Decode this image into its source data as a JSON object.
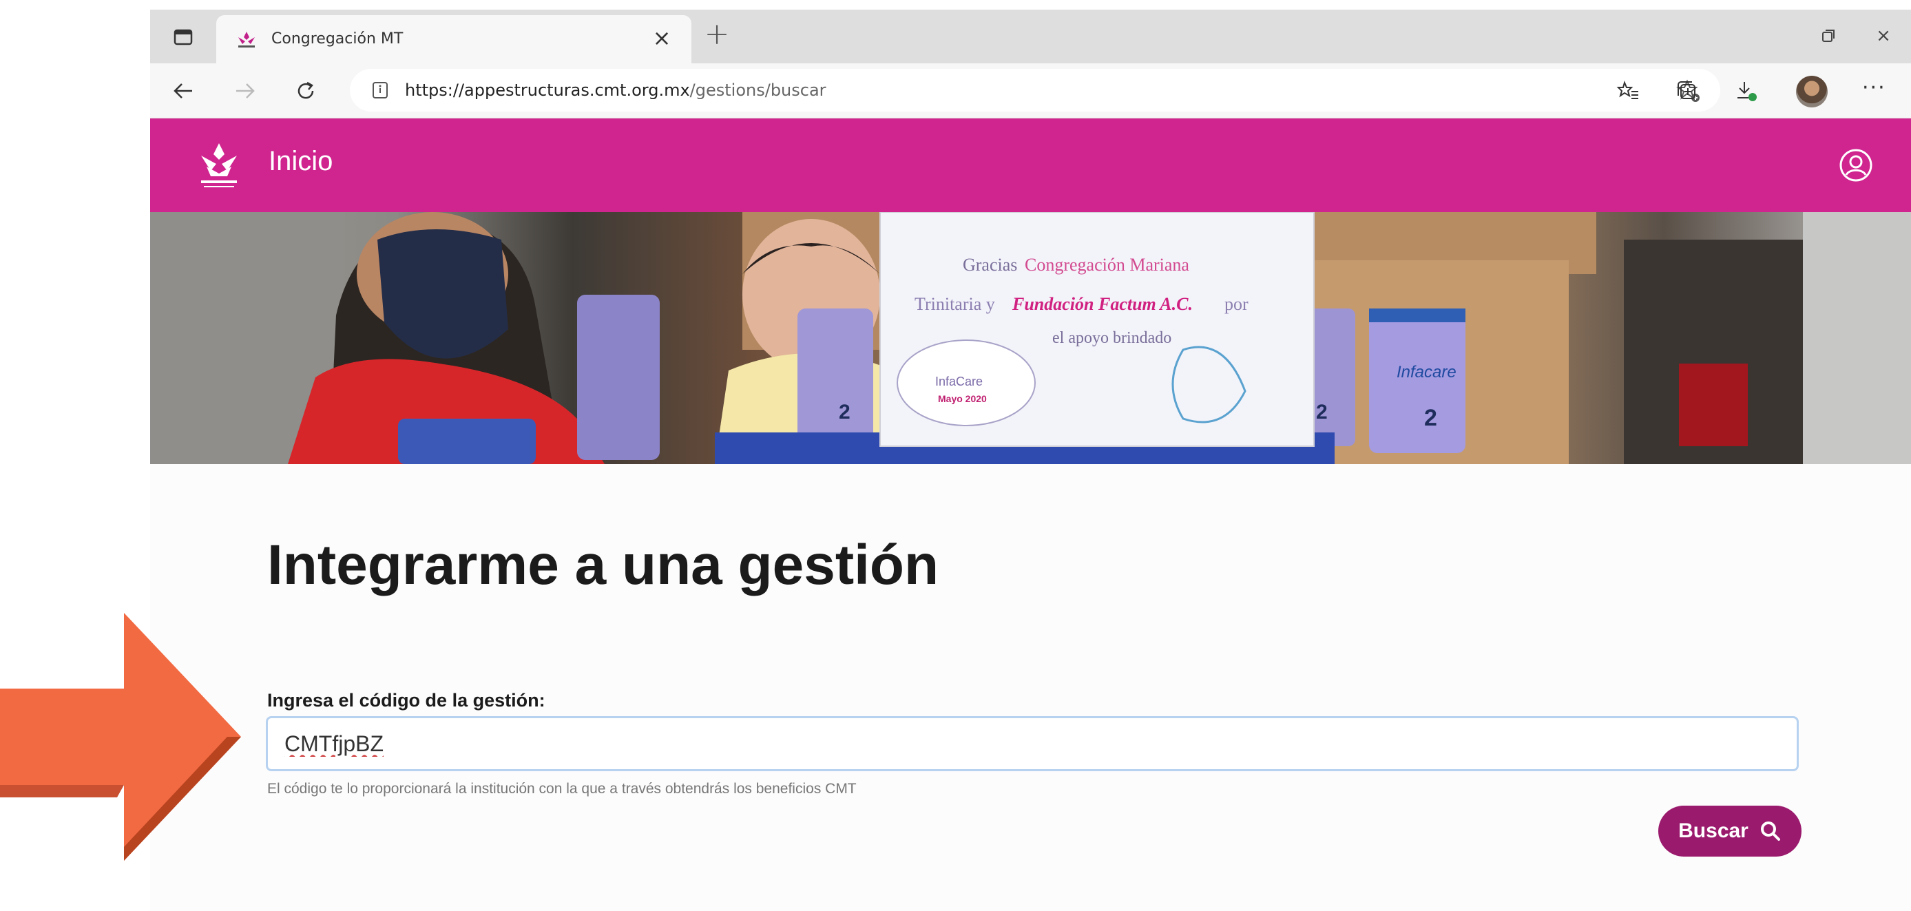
{
  "browser": {
    "tab_title": "Congregación MT",
    "url_host": "https://appestructuras.cmt.org.mx",
    "url_path": "/gestions/buscar"
  },
  "site": {
    "header_title": "Inicio",
    "brand_color": "#d0248f"
  },
  "hero": {
    "sign_line1": "Gracias",
    "sign_line1_pink": "Congregación Mariana",
    "sign_line2": "Trinitaria y",
    "sign_line2_bold": "Fundación Factum A.C.",
    "sign_line2_end": "por",
    "sign_line3": "el apoyo brindado",
    "sign_badge1": "InfaCare",
    "sign_badge2": "Mayo 2020",
    "can_label": "Infacare",
    "can_number": "2"
  },
  "main": {
    "title": "Integrarme a una gestión",
    "field_label": "Ingresa el código de la gestión:",
    "input_value": "CMTfjpBZ",
    "helper_text": "El código te lo proporcionará la institución con la que a través obtendrás los beneficios CMT",
    "search_button": "Buscar"
  },
  "colors": {
    "button": "#9a1a6d",
    "arrow": "#f26a42"
  }
}
